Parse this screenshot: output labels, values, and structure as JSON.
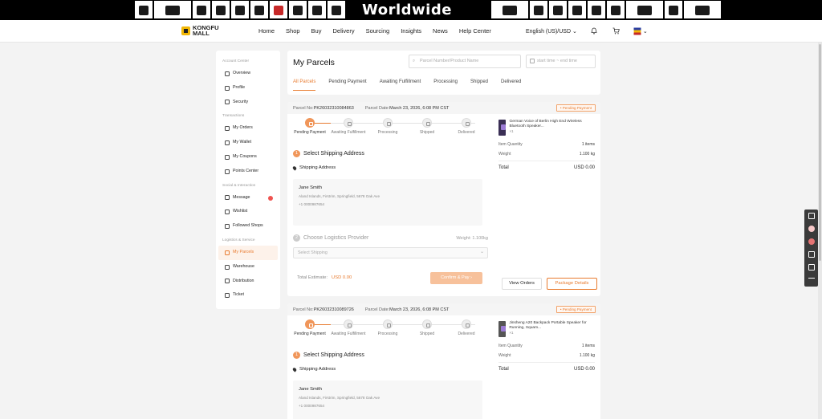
{
  "banner": {
    "title": "Worldwide Shopping"
  },
  "header": {
    "logo_line1": "KONGFU",
    "logo_line2": "MALL",
    "nav": [
      "Home",
      "Shop",
      "Buy",
      "Delivery",
      "Sourcing",
      "Insights",
      "News",
      "Help Center"
    ],
    "language": "English (US)/USD"
  },
  "sidebar": {
    "groups": [
      {
        "title": "Account Center",
        "items": [
          "Overview",
          "Profile",
          "Security"
        ]
      },
      {
        "title": "Transactions",
        "items": [
          "My Orders",
          "My Wallet",
          "My Coupons",
          "Points Center"
        ]
      },
      {
        "title": "Social & Interaction",
        "items": [
          "Message",
          "Wishlist",
          "Followed Shops"
        ]
      },
      {
        "title": "Logistics & Service",
        "items": [
          "My Parcels",
          "Warehouse",
          "Distribution",
          "Ticket"
        ]
      }
    ],
    "active": "My Parcels"
  },
  "main": {
    "title": "My Parcels",
    "search_placeholder": "Parcel Number/Product Name",
    "date_placeholder": "start time ~ end time",
    "tabs": [
      "All Parcels",
      "Pending Payment",
      "Awaiting Fulfillment",
      "Processing",
      "Shipped",
      "Delivered"
    ],
    "active_tab": "All Parcels"
  },
  "labels": {
    "parcel_no": "Parcel No:",
    "parcel_date": "Parcel Date:",
    "status_prefix": "•",
    "steps": [
      "Pending Payment",
      "Awaiting Fulfillment",
      "Processing",
      "Shipped",
      "Delivered"
    ],
    "select_shipping": "Select Shipping Address",
    "shipping_address": "Shipping Address",
    "choose_logistics": "Choose Logistics Provider",
    "select_shipping_opt": "Select Shipping",
    "total_estimate": "Total Estimate:",
    "confirm_pay": "Confirm & Pay",
    "item_quantity": "Item Quantity",
    "weight": "Weight",
    "total": "Total",
    "view_orders": "View Orders",
    "package_details": "Package Details"
  },
  "parcels": [
    {
      "number": "PK26032310084863",
      "date": "March 23, 2026, 6:08 PM CST",
      "status": "Pending Payment",
      "address_name": "Jane Smith",
      "address_line": "Aland Islands, Firstrim, Springfield, 5678 Oak Ave",
      "phone": "+1 0000987654",
      "logistics_weight": "Weight: 1.100kg",
      "estimate": "USD 0.00",
      "product_name": "German Voice of Berlin High End Wireless Bluetooth Speaker...",
      "product_qty": "×1",
      "item_quantity": "1 items",
      "weight": "1.100 kg",
      "total": "USD 0.00"
    },
    {
      "number": "PK26032310089726",
      "date": "March 23, 2026, 6:08 PM CST",
      "status": "Pending Payment",
      "address_name": "Jane Smith",
      "address_line": "Aland Islands, Firstrim, Springfield, 5678 Oak Ave",
      "phone": "+1 0000987654",
      "product_name": "Jinsheng A20 Backpack Portable Speaker for Running, Squam...",
      "product_qty": "×1",
      "item_quantity": "1 items",
      "weight": "1.100 kg",
      "total": "USD 0.00"
    }
  ]
}
